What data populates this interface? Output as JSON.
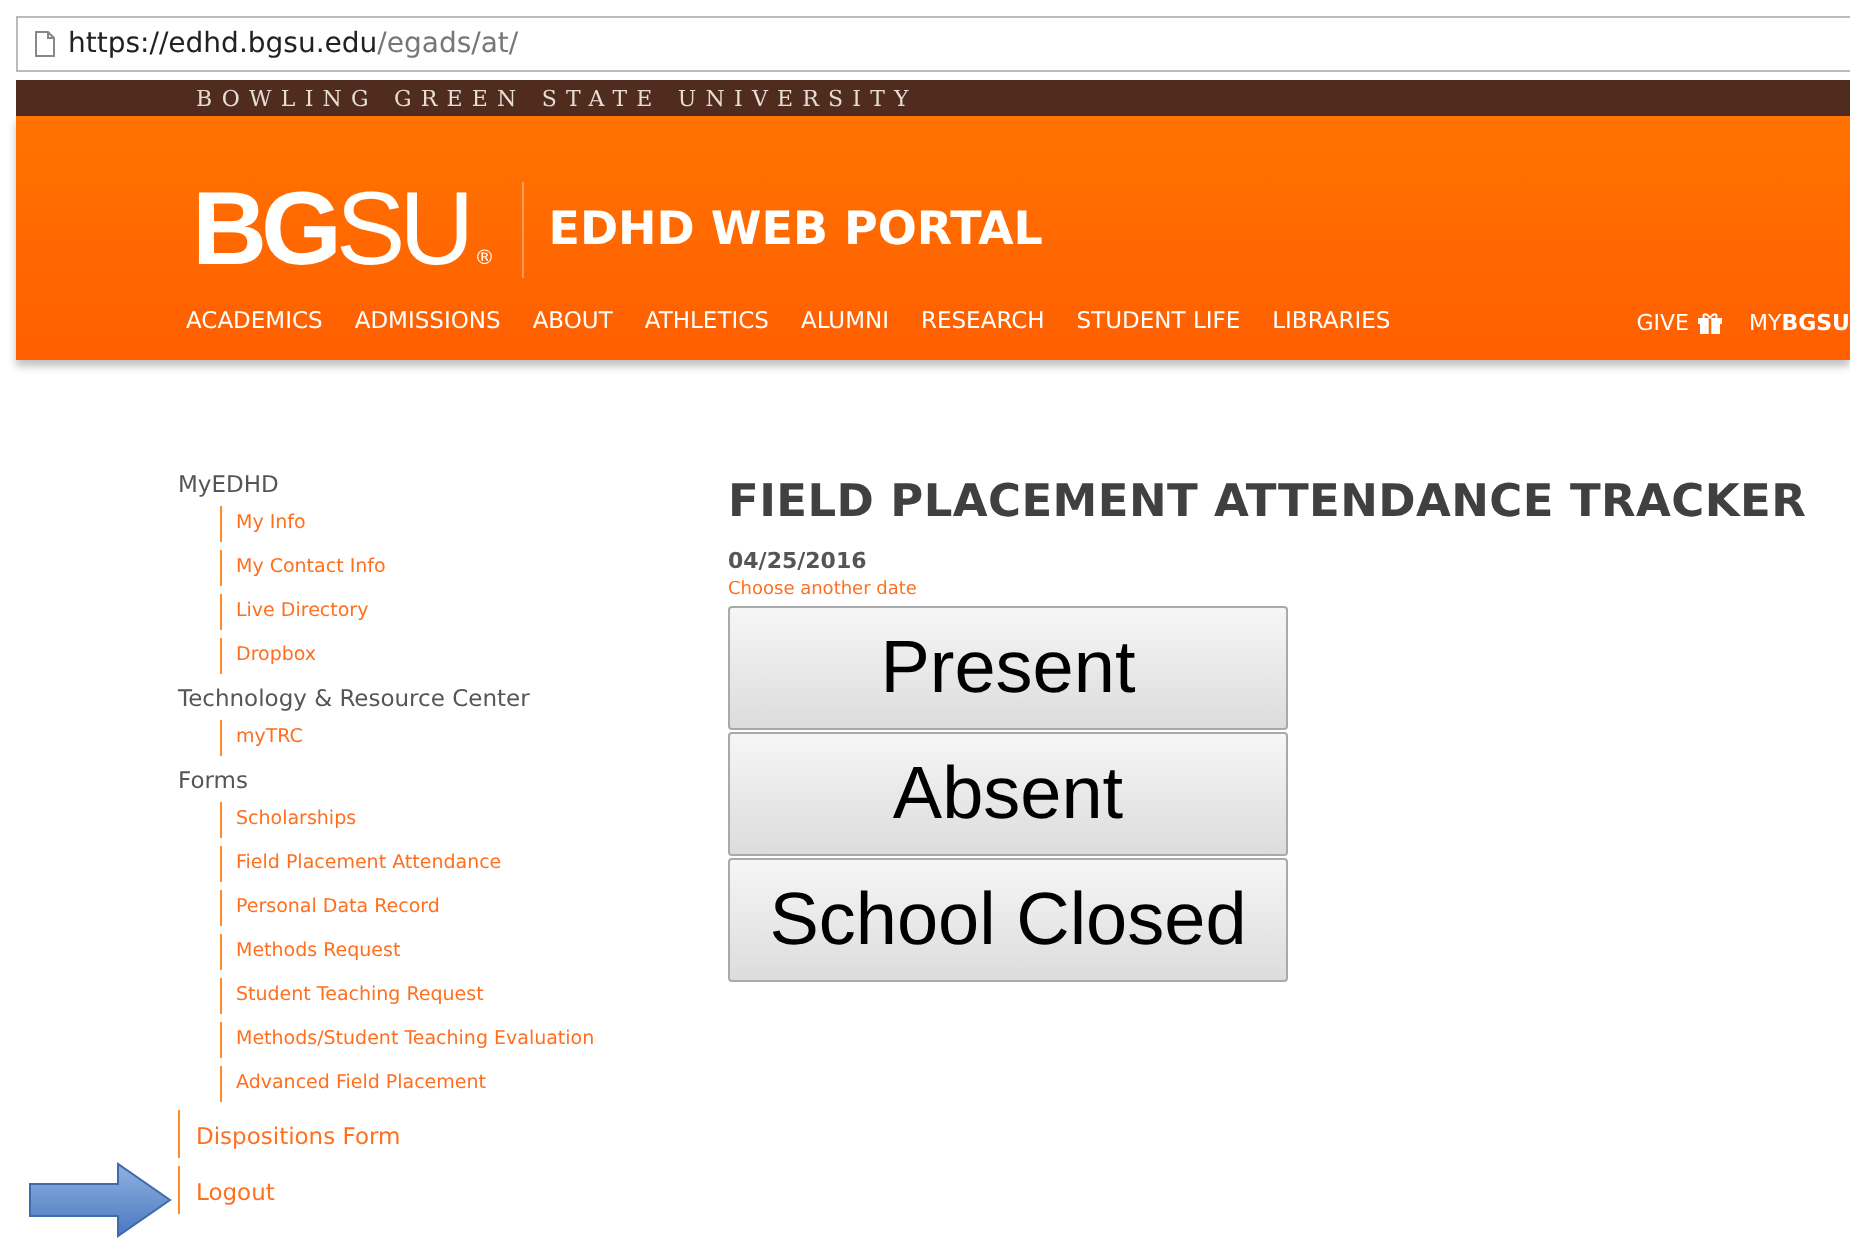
{
  "browser": {
    "url_host": "https://edhd.bgsu.edu",
    "url_path": "/egads/at/"
  },
  "header": {
    "university": "BOWLING GREEN STATE UNIVERSITY",
    "logo": "**BG**SU",
    "logo_mark": "®",
    "portal_title": "EDHD WEB PORTAL",
    "nav": [
      "ACADEMICS",
      "ADMISSIONS",
      "ABOUT",
      "ATHLETICS",
      "ALUMNI",
      "RESEARCH",
      "STUDENT LIFE",
      "LIBRARIES"
    ],
    "give": "GIVE",
    "mybgsu": "MY**BGSU**"
  },
  "sidebar": {
    "items": [
      {
        "label": "MyEDHD",
        "kind": "heading",
        "children": [
          "My Info",
          "My Contact Info",
          "Live Directory",
          "Dropbox"
        ]
      },
      {
        "label": "Technology & Resource Center",
        "kind": "heading",
        "children": [
          "myTRC"
        ]
      },
      {
        "label": "Forms",
        "kind": "heading",
        "children": [
          "Scholarships",
          "Field Placement Attendance",
          "Personal Data Record",
          "Methods Request",
          "Student Teaching Request",
          "Methods/Student Teaching Evaluation",
          "Advanced Field Placement"
        ]
      },
      {
        "label": "Dispositions Form",
        "kind": "link"
      },
      {
        "label": "Logout",
        "kind": "link",
        "pointer_arrow": true
      }
    ]
  },
  "main": {
    "title": "FIELD PLACEMENT ATTENDANCE TRACKER",
    "date": "04/25/2016",
    "date_link": "Choose another date",
    "buttons": [
      "Present",
      "Absent",
      "School Closed"
    ]
  }
}
